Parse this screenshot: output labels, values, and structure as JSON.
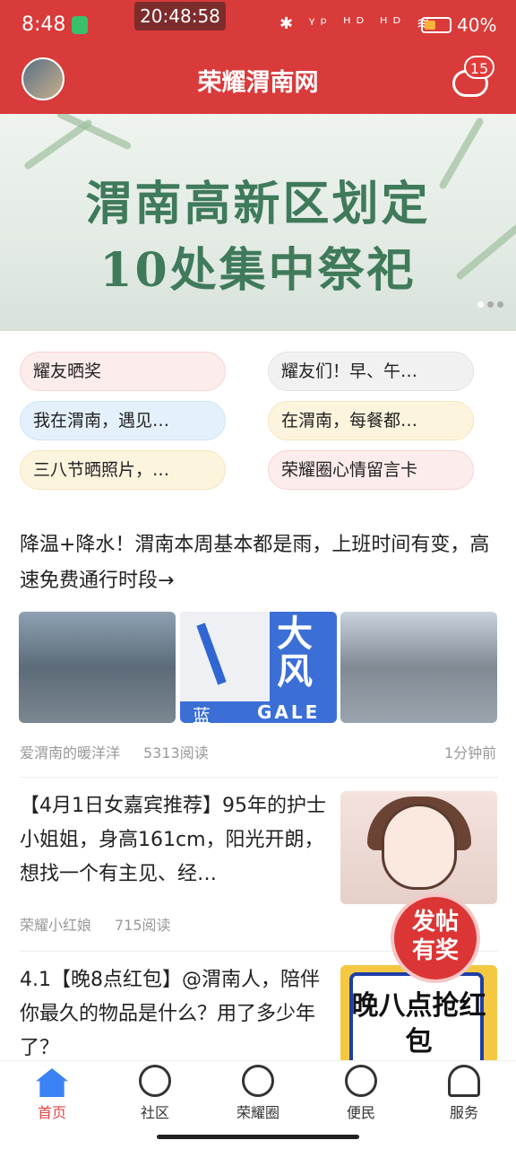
{
  "status": {
    "time": "8:48",
    "clock": "20:48:58",
    "signal_icons": "✱ ᵞᵖ ᴴᴰ ᴴᴰ ≋",
    "battery_pct": "40%",
    "battery_level": 0.4
  },
  "header": {
    "title": "荣耀渭南网",
    "message_badge": "15"
  },
  "banner": {
    "line1": "渭南高新区划定",
    "line2": "10处集中祭祀",
    "slide_index": 1,
    "slide_count": 3
  },
  "topics": [
    {
      "label": "耀友晒奖",
      "color": "pink"
    },
    {
      "label": "耀友们！早、午…",
      "color": "gray"
    },
    {
      "label": "我在渭南，遇见…",
      "color": "blue"
    },
    {
      "label": "在渭南，每餐都…",
      "color": "yellow"
    },
    {
      "label": "三八节晒照片，…",
      "color": "yellow"
    },
    {
      "label": "荣耀圈心情留言卡",
      "color": "pink"
    }
  ],
  "articles": [
    {
      "title": "降温+降水！渭南本周基本都是雨，上班时间有变，高速免费通行时段→",
      "author": "爱渭南的暖洋洋",
      "reads": "5313阅读",
      "time": "1分钟前",
      "thumb2_big": "大风",
      "thumb2_gale": "GALE",
      "thumb2_lan": "蓝"
    },
    {
      "title": "【4月1日女嘉宾推荐】95年的护士小姐姐，身高161cm，阳光开朗，想找一个有主见、经…",
      "author": "荣耀小红娘",
      "reads": "715阅读"
    },
    {
      "title": "4.1【晚8点红包】@渭南人，陪伴你最久的物品是什么？用了多少年了？",
      "thumb_text": "晚八点抢红包"
    }
  ],
  "fab": {
    "line1": "发帖",
    "line2": "有奖"
  },
  "nav": [
    {
      "label": "首页",
      "icon": "home-icon",
      "active": true
    },
    {
      "label": "社区",
      "icon": "community-icon",
      "active": false
    },
    {
      "label": "荣耀圈",
      "icon": "planet-icon",
      "active": false
    },
    {
      "label": "便民",
      "icon": "services-grid-icon",
      "active": false
    },
    {
      "label": "服务",
      "icon": "person-icon",
      "active": false
    }
  ]
}
